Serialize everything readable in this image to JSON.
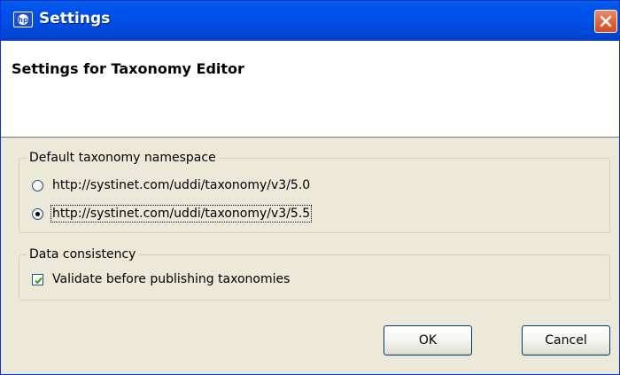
{
  "window": {
    "title": "Settings"
  },
  "header": {
    "title": "Settings for Taxonomy Editor"
  },
  "namespace_group": {
    "label": "Default taxonomy namespace",
    "options": [
      {
        "label": "http://systinet.com/uddi/taxonomy/v3/5.0",
        "selected": false
      },
      {
        "label": "http://systinet.com/uddi/taxonomy/v3/5.5",
        "selected": true
      }
    ]
  },
  "consistency_group": {
    "label": "Data consistency",
    "validate_label": "Validate before publishing taxonomies",
    "validate_checked": true
  },
  "buttons": {
    "ok_label": "OK",
    "cancel_label": "Cancel"
  },
  "colors": {
    "titlebar": "#0053ee",
    "window_bg": "#ece9d8",
    "close_button": "#e06c45"
  }
}
